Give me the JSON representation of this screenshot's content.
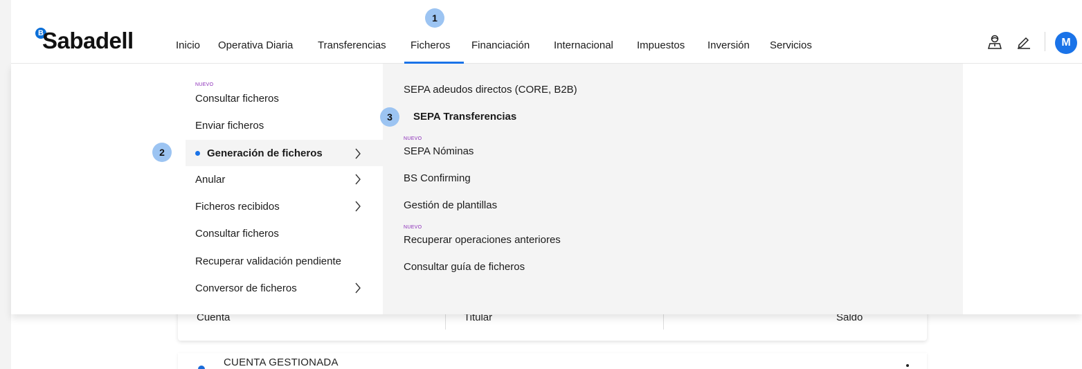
{
  "brand": {
    "name": "Sabadell",
    "badge": "B"
  },
  "nav": {
    "items": [
      "Inicio",
      "Operativa Diaria",
      "Transferencias",
      "Ficheros",
      "Financiación",
      "Internacional",
      "Impuestos",
      "Inversión",
      "Servicios"
    ],
    "active": "Ficheros"
  },
  "user": {
    "initial": "M"
  },
  "steps": [
    "1",
    "2",
    "3"
  ],
  "submenu": {
    "new_badge": "NUEVO",
    "items": [
      {
        "label": "Consultar ficheros",
        "new": true
      },
      {
        "label": "Enviar ficheros"
      },
      {
        "label": "Generación de ficheros",
        "active": true,
        "has_children": true
      },
      {
        "label": "Anular",
        "has_children": true
      },
      {
        "label": "Ficheros recibidos",
        "has_children": true
      },
      {
        "label": "Consultar ficheros"
      },
      {
        "label": "Recuperar validación pendiente"
      },
      {
        "label": "Conversor de ficheros",
        "has_children": true
      }
    ]
  },
  "generation_menu": {
    "items": [
      {
        "label": "SEPA adeudos directos (CORE, B2B)"
      },
      {
        "label": "SEPA Transferencias",
        "highlight": true
      },
      {
        "label": "SEPA Nóminas",
        "new": true
      },
      {
        "label": "BS Confirming"
      },
      {
        "label": "Gestión de plantillas"
      },
      {
        "label": "Recuperar operaciones anteriores",
        "new": true
      },
      {
        "label": "Consultar guía de ficheros"
      }
    ]
  },
  "background": {
    "table_headers": [
      "Cuenta",
      "Titular",
      "Saldo"
    ],
    "account_type": "CUENTA GESTIONADA"
  },
  "colors": {
    "accent": "#1a73e8",
    "step": "#9cc4f2",
    "new_badge": "#8a2bb8"
  }
}
